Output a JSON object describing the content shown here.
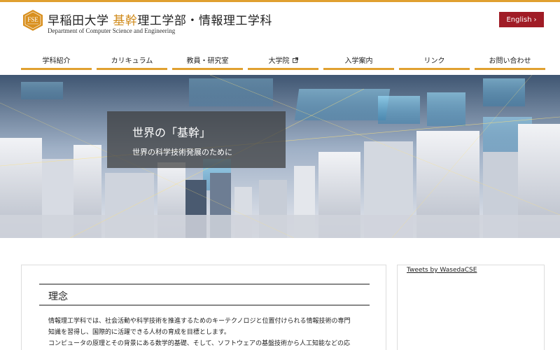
{
  "header": {
    "title_part1": "早稲田大学 ",
    "title_accent": "基幹",
    "title_part2": "理工学部・情報理工学科",
    "subtitle": "Department of Computer Science and Engineering",
    "logo_text": "FSE",
    "english_label": "English",
    "english_chevron": "›"
  },
  "nav": {
    "items": [
      {
        "label": "学科紹介"
      },
      {
        "label": "カリキュラム"
      },
      {
        "label": "教員・研究室"
      },
      {
        "label": "大学院"
      },
      {
        "label": "入学案内"
      },
      {
        "label": "リンク"
      },
      {
        "label": "お問い合わせ"
      }
    ]
  },
  "hero": {
    "title": "世界の「基幹」",
    "subtitle": "世界の科学技術発展のために"
  },
  "main": {
    "heading": "理念",
    "paragraph": [
      "情報理工学科では、社会活動や科学技術を推進するためのキーテクノロジと位置付けられる情報技術の専門",
      "知識を習得し、国際的に活躍できる人材の育成を目標とします。",
      "コンピュータの原理とその背景にある数学的基礎、そして、ソフトウェアの基盤技術から人工知能などの応"
    ]
  },
  "sidebar": {
    "tweets_label": "Tweets by WasedaCSE"
  },
  "colors": {
    "accent": "#e0a030",
    "title_accent": "#d08a1a",
    "english_button": "#a01c26"
  }
}
